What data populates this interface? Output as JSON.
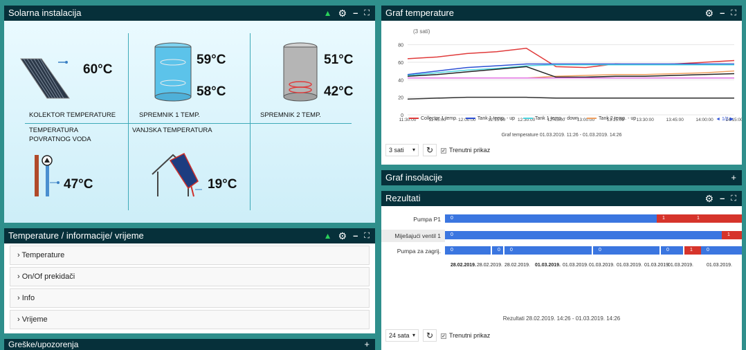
{
  "solar": {
    "title": "Solarna instalacija",
    "collector": {
      "temp": "60°C",
      "label": "KOLEKTOR TEMPERATURE"
    },
    "tank1": {
      "top": "59°C",
      "bottom": "58°C",
      "label": "SPREMNIK 1 TEMP."
    },
    "tank2": {
      "top": "51°C",
      "bottom": "42°C",
      "label": "SPREMNIK 2 TEMP."
    },
    "return": {
      "label": "TEMPERATURA POVRATNOG VODA",
      "temp": "47°C"
    },
    "outside": {
      "label": "VANJSKA TEMPERATURA",
      "temp": "19°C"
    }
  },
  "info": {
    "title": "Temperature / informacije/ vrijeme",
    "items": [
      "Temperature",
      "On/Of prekidači",
      "Info",
      "Vrijeme"
    ]
  },
  "errors": {
    "title": "Greške/upozorenja"
  },
  "graph": {
    "title": "Graf temperature",
    "note": "(3 sati)",
    "caption": "Graf temperature 01.03.2019. 11:26 - 01.03.2019. 14:26",
    "select": "3 sati",
    "live": "Trenutni prikaz",
    "pager": "1/2",
    "chart_data": {
      "type": "line",
      "x": [
        "11:30:00",
        "11:45:00",
        "12:00:00",
        "12:15:00",
        "12:30:00",
        "12:45:00",
        "13:00:00",
        "13:15:00",
        "13:30:00",
        "13:45:00",
        "14:00:00",
        "14:15:00"
      ],
      "ylim": [
        0,
        90
      ],
      "yticks": [
        0,
        20,
        40,
        60,
        80
      ],
      "series": [
        {
          "name": "Collector 1 temp.",
          "color": "#e03a3a",
          "values": [
            64,
            66,
            70,
            72,
            76,
            55,
            54,
            58,
            57,
            58,
            60,
            62
          ]
        },
        {
          "name": "Tank 1 temp. - up",
          "color": "#2b4fd4",
          "values": [
            46,
            50,
            54,
            56,
            58,
            58,
            58,
            58,
            58,
            58,
            58,
            58
          ]
        },
        {
          "name": "Tank 1 temp. - down",
          "color": "#4fd6e0",
          "values": [
            45,
            48,
            51,
            53,
            56,
            57,
            57,
            57,
            57,
            57,
            57,
            57
          ]
        },
        {
          "name": "Tank 2 temp. - up",
          "color": "#f0a060",
          "values": [
            42,
            42,
            42,
            42,
            42,
            44,
            45,
            46,
            46,
            47,
            48,
            50
          ]
        },
        {
          "name": "",
          "color": "#222222",
          "values": [
            44,
            46,
            49,
            52,
            55,
            43,
            43,
            44,
            44,
            45,
            46,
            47
          ]
        },
        {
          "name": "",
          "color": "#e070e0",
          "values": [
            42,
            42,
            42,
            42,
            42,
            42,
            42,
            42,
            42,
            42,
            42,
            42
          ]
        },
        {
          "name": "",
          "color": "#333333",
          "values": [
            18,
            19,
            20,
            20,
            20,
            19,
            19,
            19,
            19,
            19,
            19,
            19
          ]
        }
      ]
    }
  },
  "insolation": {
    "title": "Graf insolacije"
  },
  "results": {
    "title": "Rezultati",
    "rows": [
      "Pumpa P1",
      "Miješajući ventil 1",
      "Pumpa za zagrij."
    ],
    "values": {
      "p1": [
        "0",
        "1",
        "1"
      ],
      "mv": [
        "0",
        "1"
      ],
      "pz": [
        "0",
        "0",
        "0",
        "0",
        "0",
        "0",
        "1",
        "0"
      ]
    },
    "dates": [
      "28.02.2019.",
      "28.02.2019.",
      "28.02.2019.",
      "01.03.2019.",
      "01.03.2019.",
      "01.03.2019.",
      "01.03.2019.",
      "01.03.2019.",
      "01.03.2019.",
      "01.03.2019."
    ],
    "caption": "Rezultati  28.02.2019. 14:26 - 01.03.2019. 14:26",
    "select": "24 sata",
    "live": "Trenutni prikaz"
  }
}
